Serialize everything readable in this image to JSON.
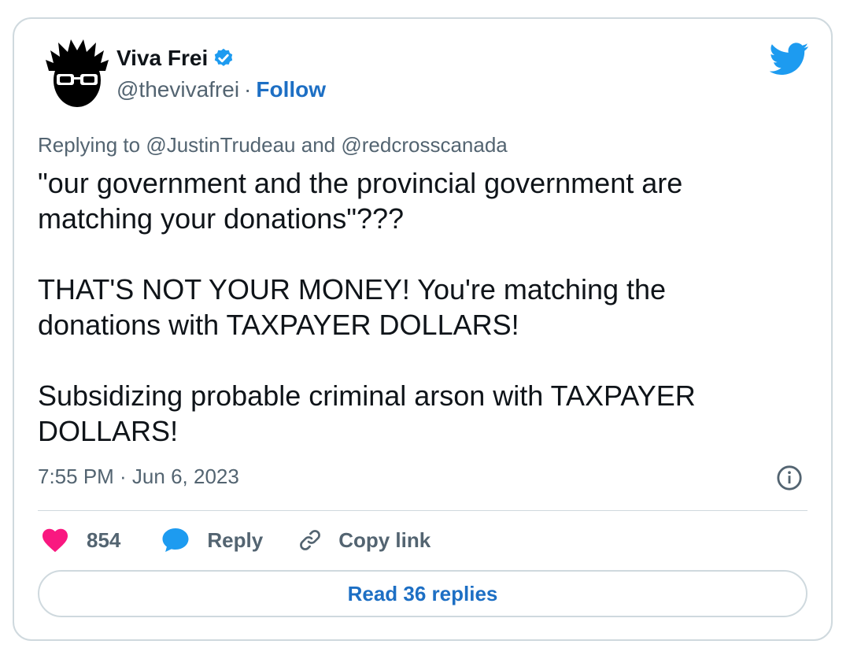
{
  "author": {
    "display_name": "Viva Frei",
    "handle": "@thevivafrei",
    "separator": "·",
    "follow_label": "Follow"
  },
  "reply_context": {
    "prefix": "Replying to",
    "mention_1": "@JustinTrudeau",
    "conjunction": "and",
    "mention_2": "@redcrosscanada"
  },
  "tweet": {
    "paragraphs": [
      "\"our government and the provincial government are matching your donations\"???",
      "THAT'S NOT YOUR MONEY! You're matching the donations with TAXPAYER DOLLARS!",
      "Subsidizing probable criminal arson with TAXPAYER DOLLARS!"
    ],
    "timestamp": "7:55 PM · Jun 6, 2023"
  },
  "actions": {
    "like_count": "854",
    "reply_label": "Reply",
    "copy_link_label": "Copy link",
    "read_replies_label": "Read 36 replies"
  },
  "colors": {
    "accent": "#1d6fc4",
    "twitter_blue": "#1d9bf0",
    "like_pink": "#f91880",
    "muted_text": "#536471",
    "border": "#cfd9de"
  },
  "icons": [
    "avatar-image",
    "verified-badge-icon",
    "twitter-bird-icon",
    "info-icon",
    "heart-icon",
    "speech-bubble-icon",
    "link-icon"
  ]
}
